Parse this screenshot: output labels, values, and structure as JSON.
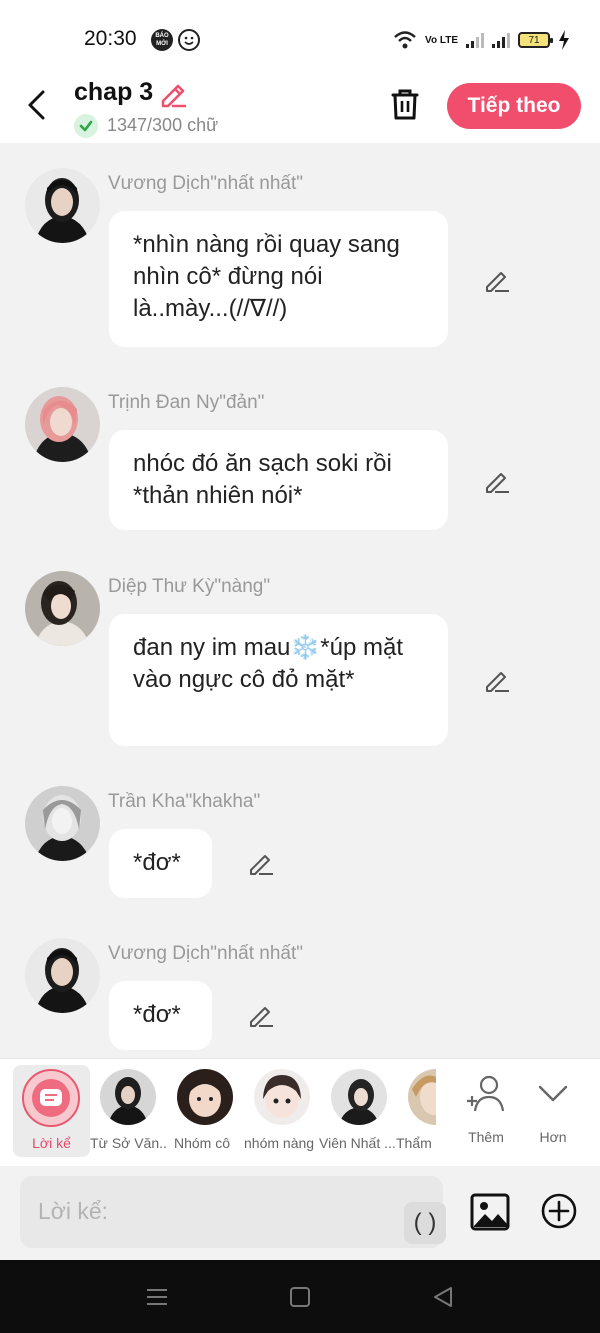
{
  "status_bar": {
    "time": "20:30",
    "badge_text": "BÁO MỚI",
    "volte": "Vo LTE",
    "battery": "71"
  },
  "header": {
    "title": "chap 3",
    "word_count": "1347/300 chữ",
    "next_button": "Tiếp theo",
    "accent_color": "#f04e6c"
  },
  "messages": [
    {
      "sender": "Vương Dịch\"nhất nhất\"",
      "text": "*nhìn nàng rồi quay sang nhìn cô* đừng nói là..mày...(//∇//)"
    },
    {
      "sender": "Trịnh Đan Ny\"đản\"",
      "text": "nhóc đó ăn sạch soki rồi *thản nhiên nói*"
    },
    {
      "sender": "Diệp Thư Kỳ\"nàng\"",
      "text": "đan ny im mau❄️*úp mặt vào ngực cô đỏ mặt*"
    },
    {
      "sender": "Trần Kha\"khakha\"",
      "text": "*đơ*"
    },
    {
      "sender": "Vương Dịch\"nhất nhất\"",
      "text": "*đơ*"
    }
  ],
  "characters": {
    "narrator_label": "Lời kể",
    "items": [
      "Từ Sở Văn...",
      "Nhóm cô",
      "nhóm nàng",
      "Viên Nhất ...",
      "Thẩm"
    ],
    "more_label": "Thêm",
    "less_label": "Hơn"
  },
  "input": {
    "placeholder": "Lời kể:",
    "paren_button": "( )"
  }
}
